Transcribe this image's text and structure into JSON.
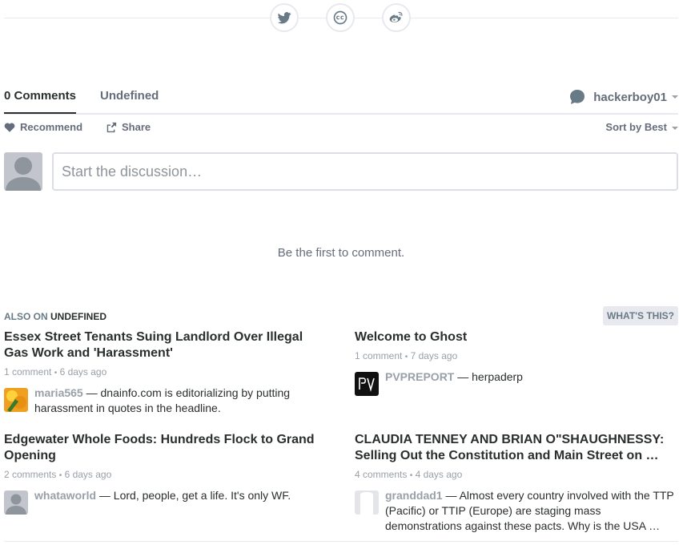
{
  "share": {
    "icons": [
      "twitter-icon",
      "creative-commons-icon",
      "weibo-icon"
    ]
  },
  "nav": {
    "tabs": [
      {
        "label": "0 Comments"
      },
      {
        "label": "Undefined"
      }
    ],
    "user": {
      "name": "hackerboy01"
    }
  },
  "toolbar": {
    "recommend": "Recommend",
    "share": "Share",
    "sort": "Sort by Best"
  },
  "composer": {
    "placeholder": "Start the discussion…"
  },
  "empty_message": "Be the first to comment.",
  "also_on": {
    "prefix": "ALSO ON",
    "site": "UNDEFINED",
    "whats_this": "WHAT'S THIS?"
  },
  "cards": [
    {
      "title": "Essex Street Tenants Suing Landlord Over Illegal Gas Work and 'Harassment'",
      "count": "1 comment",
      "age": "6 days ago",
      "user": "maria565",
      "text": "dnainfo.com is editorializing by putting harassment in quotes in the headline."
    },
    {
      "title": "Welcome to Ghost",
      "count": "1 comment",
      "age": "7 days ago",
      "user": "PVPREPORT",
      "text": "herpaderp"
    },
    {
      "title": "Edgewater Whole Foods: Hundreds Flock to Grand Opening",
      "count": "2 comments",
      "age": "6 days ago",
      "user": "whataworld",
      "text": "Lord, people, get a life. It's only WF."
    },
    {
      "title": "CLAUDIA TENNEY AND BRIAN O\"SHAUGHNESSY: Selling Out the Constitution and Main Street on …",
      "count": "4 comments",
      "age": "4 days ago",
      "user": "granddad1",
      "text": "Almost every country involved with the TTP (Pacific) or TTIP (Europe) are staging mass demonstrations against these pacts. Why is the USA …"
    }
  ],
  "colors": {
    "text": "#2a2e2e",
    "muted": "#656c7a",
    "light": "#99a0a8",
    "border": "#e7e9ee"
  }
}
